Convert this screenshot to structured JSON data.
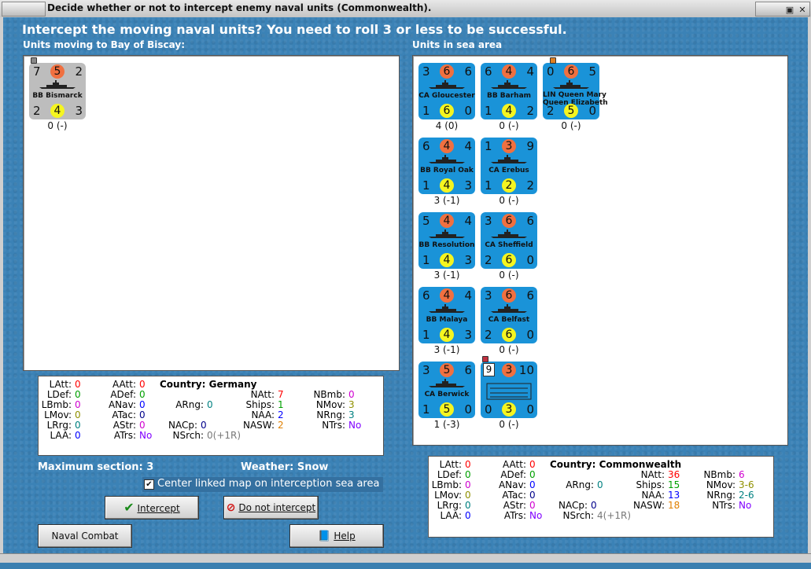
{
  "window": {
    "title": "Decide whether or not to intercept enemy naval units (Commonwealth)."
  },
  "heading": "Intercept the moving naval units?  You need to roll 3 or less to be successful.",
  "left_label": "Units moving to Bay of Biscay:",
  "right_label": "Units in sea area",
  "moving_units": [
    {
      "tl": "7",
      "tc": "5",
      "tr": "2",
      "name": "BB Bismarck",
      "bl": "2",
      "bc": "4",
      "br": "3",
      "value": "0 (-)"
    }
  ],
  "sea_units": [
    {
      "tl": "3",
      "tc": "6",
      "tr": "6",
      "name": "CA Gloucester",
      "bl": "1",
      "bc": "6",
      "br": "0",
      "value": "4 (0)"
    },
    {
      "tl": "6",
      "tc": "4",
      "tr": "4",
      "name": "BB Barham",
      "bl": "1",
      "bc": "4",
      "br": "2",
      "value": "0 (-)"
    },
    {
      "tl": "0",
      "tc": "6",
      "tr": "5",
      "name": "LIN Queen Mary\nQueen Elizabeth",
      "bl": "2",
      "bc": "5",
      "br": "0",
      "value": "0 (-)"
    },
    {
      "tl": "6",
      "tc": "4",
      "tr": "4",
      "name": "BB Royal Oak",
      "bl": "1",
      "bc": "4",
      "br": "3",
      "value": "3 (-1)"
    },
    {
      "tl": "1",
      "tc": "3",
      "tr": "9",
      "name": "CA Erebus",
      "bl": "1",
      "bc": "2",
      "br": "2",
      "value": "0 (-)"
    },
    {
      "tl": "5",
      "tc": "4",
      "tr": "4",
      "name": "BB Resolution",
      "bl": "1",
      "bc": "4",
      "br": "3",
      "value": "3 (-1)"
    },
    {
      "tl": "3",
      "tc": "6",
      "tr": "6",
      "name": "CA Sheffield",
      "bl": "2",
      "bc": "6",
      "br": "0",
      "value": "0 (-)"
    },
    {
      "tl": "6",
      "tc": "4",
      "tr": "4",
      "name": "BB Malaya",
      "bl": "1",
      "bc": "4",
      "br": "3",
      "value": "3 (-1)"
    },
    {
      "tl": "3",
      "tc": "6",
      "tr": "6",
      "name": "CA Belfast",
      "bl": "2",
      "bc": "6",
      "br": "0",
      "value": "0 (-)"
    },
    {
      "tl": "3",
      "tc": "5",
      "tr": "6",
      "name": "CA Berwick",
      "bl": "1",
      "bc": "5",
      "br": "0",
      "value": "1 (-3)"
    },
    {
      "tl": "9",
      "tc": "3",
      "tr": "10",
      "name": "",
      "bl": "0",
      "bc": "3",
      "br": "0",
      "value": "0 (-)"
    }
  ],
  "stats_left": {
    "LAtt": "0",
    "LDef": "0",
    "LBmb": "0",
    "LMov": "0",
    "LRrg": "0",
    "LAA": "0",
    "AAtt": "0",
    "ADef": "0",
    "ANav": "0",
    "ATac": "0",
    "AStr": "0",
    "ATrs": "No",
    "country": "Country: Germany",
    "ARng": "0",
    "NACp": "0",
    "NSrch": "0(+1R)",
    "NAtt": "7",
    "Ships": "1",
    "NAA": "2",
    "NASW": "2",
    "NBmb": "0",
    "NMov": "3",
    "NRng": "3",
    "NTrs": "No"
  },
  "stats_right": {
    "LAtt": "0",
    "LDef": "0",
    "LBmb": "0",
    "LMov": "0",
    "LRrg": "0",
    "LAA": "0",
    "AAtt": "0",
    "ADef": "0",
    "ANav": "0",
    "ATac": "0",
    "AStr": "0",
    "ATrs": "No",
    "country": "Country: Commonwealth",
    "ARng": "0",
    "NACp": "0",
    "NSrch": "4(+1R)",
    "NAtt": "36",
    "Ships": "15",
    "NAA": "13",
    "NASW": "18",
    "NBmb": "6",
    "NMov": "3-6",
    "NRng": "2-6",
    "NTrs": "No"
  },
  "labels": {
    "LAtt": "LAtt:",
    "LDef": "LDef:",
    "LBmb": "LBmb:",
    "LMov": "LMov:",
    "LRrg": "LRrg:",
    "LAA": "LAA:",
    "AAtt": "AAtt:",
    "ADef": "ADef:",
    "ANav": "ANav:",
    "ATac": "ATac:",
    "AStr": "AStr:",
    "ATrs": "ATrs:",
    "ARng": "ARng:",
    "NACp": "NACp:",
    "NSrch": "NSrch:",
    "NAtt": "NAtt:",
    "Ships": "Ships:",
    "NAA": "NAA:",
    "NASW": "NASW:",
    "NBmb": "NBmb:",
    "NMov": "NMov:",
    "NRng": "NRng:",
    "NTrs": "NTrs:"
  },
  "max_section": "Maximum section: 3",
  "weather": "Weather:  Snow",
  "center_checkbox": {
    "label": "Center linked map on interception sea area",
    "checked": true
  },
  "buttons": {
    "intercept": "Intercept",
    "do_not_intercept": "Do not intercept",
    "naval_combat_chart": "Naval Combat Chart",
    "help": "Help"
  },
  "colors": {
    "red": "#ff0000",
    "green": "#00a000",
    "magenta": "#d000d0",
    "blue": "#0000ff",
    "olive": "#909000",
    "teal": "#008080",
    "orange": "#e08000",
    "navy": "#00008b",
    "gray": "#777777",
    "purple": "#8000ff"
  }
}
